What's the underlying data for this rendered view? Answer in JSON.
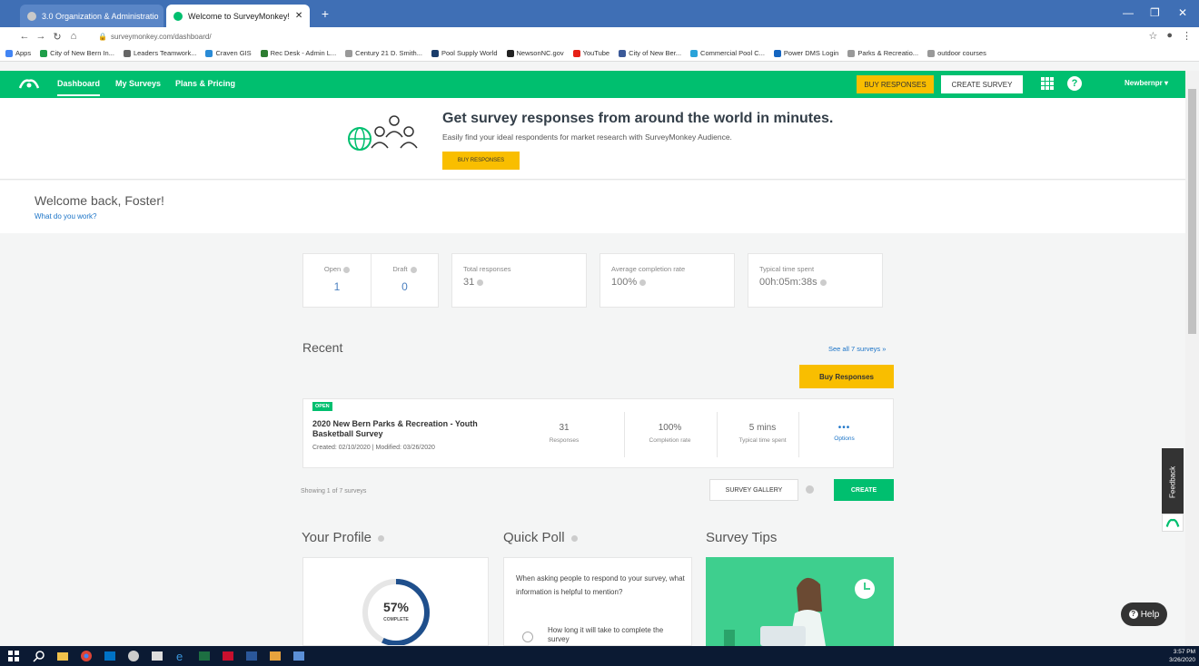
{
  "browser": {
    "tabs": [
      {
        "title": "3.0 Organization & Administratio",
        "active": false
      },
      {
        "title": "Welcome to SurveyMonkey!",
        "active": true
      }
    ],
    "new_tab": "+",
    "url": "surveymonkey.com/dashboard/",
    "bookmarks": [
      "Apps",
      "City of New Bern In...",
      "Leaders Teamwork...",
      "Craven GIS",
      "Rec Desk - Admin L...",
      "Century 21 D. Smith...",
      "Pool Supply World",
      "NewsonNC.gov",
      "YouTube",
      "City of New Ber...",
      "Commercial Pool C...",
      "Power DMS Login",
      "Parks & Recreatio...",
      "outdoor courses"
    ]
  },
  "nav": {
    "dashboard": "Dashboard",
    "my_surveys": "My Surveys",
    "plans": "Plans & Pricing",
    "buy_responses": "BUY RESPONSES",
    "create_survey": "CREATE SURVEY",
    "user": "Newbernpr"
  },
  "banner": {
    "title": "Get survey responses from around the world in minutes.",
    "subtitle": "Easily find your ideal respondents for market research with SurveyMonkey Audience.",
    "button": "BUY RESPONSES"
  },
  "welcome": {
    "title": "Welcome back, Foster!",
    "link": "What do you work?"
  },
  "stats": {
    "open_label": "Open",
    "open_value": "1",
    "draft_label": "Draft",
    "draft_value": "0",
    "total_label": "Total responses",
    "total_value": "31",
    "completion_label": "Average completion rate",
    "completion_value": "100%",
    "time_label": "Typical time spent",
    "time_value": "00h:05m:38s"
  },
  "recent": {
    "title": "Recent",
    "see_all": "See all 7 surveys »",
    "buy_button": "Buy Responses",
    "survey": {
      "status": "OPEN",
      "title": "2020 New Bern Parks & Recreation - Youth Basketball Survey",
      "dates": "Created: 02/10/2020  |  Modified: 03/26/2020",
      "responses_value": "31",
      "responses_label": "Responses",
      "completion_value": "100%",
      "completion_label": "Completion rate",
      "time_value": "5 mins",
      "time_label": "Typical time spent",
      "options_label": "Options"
    },
    "showing": "Showing 1 of 7 surveys",
    "gallery_button": "SURVEY GALLERY",
    "create_button": "CREATE"
  },
  "profile": {
    "title": "Your Profile",
    "percent": "57%",
    "percent_value": 0.57,
    "label": "COMPLETE"
  },
  "poll": {
    "title": "Quick Poll",
    "question": "When asking people to respond to your survey, what information is helpful to mention?",
    "option1": "How long it will take to complete the survey"
  },
  "tips": {
    "title": "Survey Tips"
  },
  "side": {
    "feedback": "Feedback",
    "help": "Help"
  },
  "clock": {
    "time": "3:57 PM",
    "date": "3/26/2020"
  },
  "colors": {
    "brand_green": "#00bf6f",
    "accent_yellow": "#f9be00",
    "chrome_blue": "#3f6fb5",
    "taskbar": "#0b1a33"
  }
}
